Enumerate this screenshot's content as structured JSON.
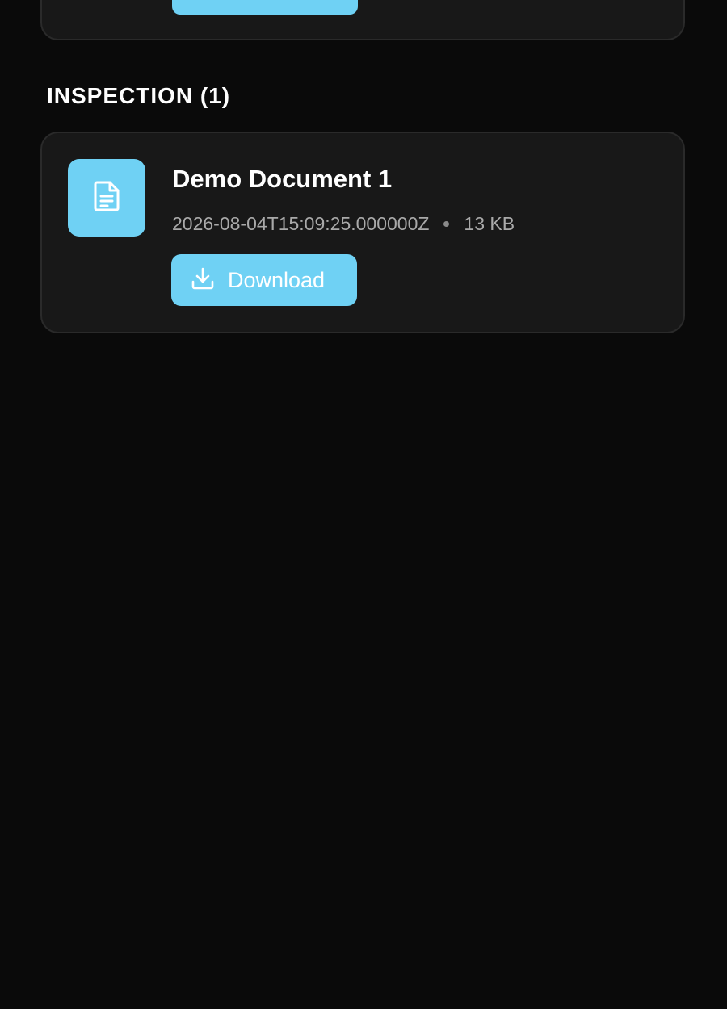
{
  "colors": {
    "background": "#0a0a0a",
    "card": "#181818",
    "card_border": "#2a2a2a",
    "accent": "#6fd1f4",
    "meta_text": "#a9a9a9"
  },
  "section": {
    "title": "INSPECTION (1)"
  },
  "documents": [
    {
      "title": "Demo Document 1",
      "timestamp": "2026-08-04T15:09:25.000000Z",
      "size": "13 KB",
      "download_label": "Download",
      "icon": "document-icon"
    }
  ],
  "icons": {
    "download": "download-icon"
  }
}
